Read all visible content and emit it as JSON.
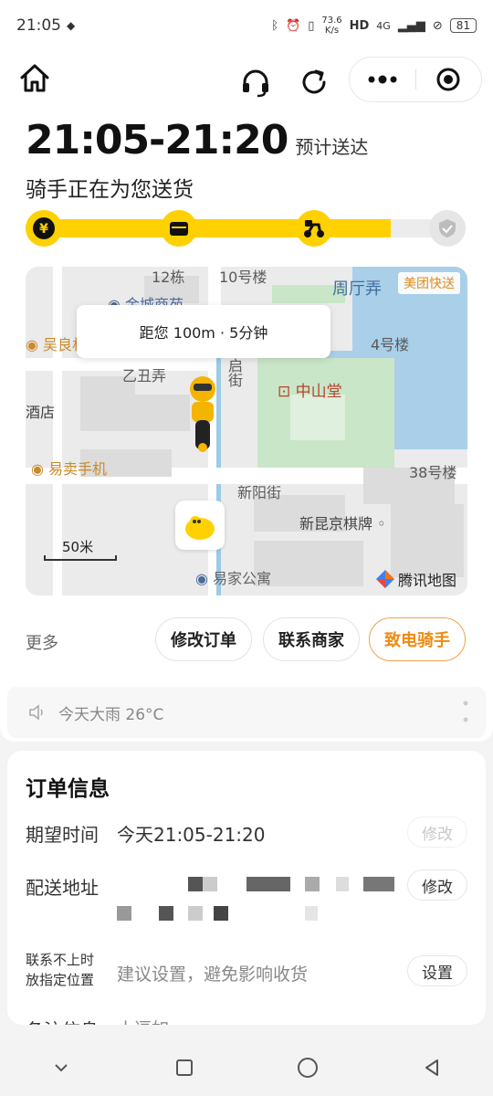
{
  "status_bar": {
    "time": "21:05",
    "net_speed_value": "73.6",
    "net_speed_unit": "K/s",
    "network": "4G",
    "battery": "81"
  },
  "header": {
    "eta_time": "21:05-21:20",
    "eta_label": "预计送达",
    "status": "骑手正在为您送货"
  },
  "progress": {
    "fraction": 0.83,
    "steps": [
      {
        "icon": "yen-icon",
        "state": "done"
      },
      {
        "icon": "shop-icon",
        "state": "done"
      },
      {
        "icon": "scooter-icon",
        "state": "done"
      },
      {
        "icon": "check-icon",
        "state": "pending"
      }
    ]
  },
  "map": {
    "distance_info": "距您 100m · 5分钟",
    "tag": "美团快送",
    "scale": "50米",
    "provider": "腾讯地图",
    "labels": {
      "l1": "12栋",
      "l2": "10号楼",
      "l3": "周厅弄",
      "l4": "金城商苑",
      "l5": "4号楼",
      "l6": "乙丑弄",
      "l7": "启街",
      "l8": "中山堂",
      "l9": "酒店",
      "l10": "易卖手机",
      "l11": "38号楼",
      "l12": "新阳街",
      "l13": "新昆京棋牌",
      "l14": "易家公寓",
      "l15": "吴良材"
    }
  },
  "actions": {
    "more": "更多",
    "modify_order": "修改订单",
    "contact_merchant": "联系商家",
    "call_rider": "致电骑手"
  },
  "weather": {
    "text": "今天大雨 26°C"
  },
  "order_info": {
    "title": "订单信息",
    "expected_time": {
      "label": "期望时间",
      "value": "今天21:05-21:20",
      "button": "修改"
    },
    "address": {
      "label": "配送地址",
      "button": "修改"
    },
    "fallback": {
      "label_line1": "联系不上时",
      "label_line2": "放指定位置",
      "value": "建议设置，避免影响收货",
      "button": "设置"
    },
    "remark": {
      "label": "备注信息",
      "value": "小逗如"
    }
  },
  "colors": {
    "brand_yellow": "#ffd100",
    "accent_orange": "#f08a12",
    "map_water": "#a9cfe9",
    "map_park": "#c9e6c8"
  }
}
